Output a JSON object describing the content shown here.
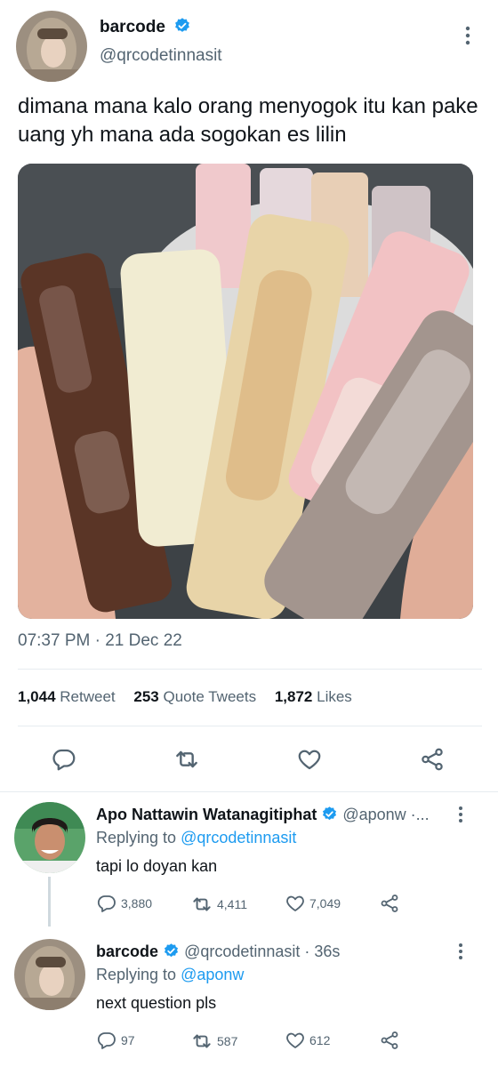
{
  "tweet": {
    "author_name": "barcode",
    "author_handle": "@qrcodetinnasit",
    "text": "dimana mana kalo orang menyogok itu kan pake uang yh mana ada sogokan es lilin",
    "timestamp": "07:37 PM · 21 Dec 22",
    "stats": {
      "retweets": "1,044",
      "retweets_label": "Retweet",
      "quotes": "253",
      "quotes_label": "Quote Tweets",
      "likes": "1,872",
      "likes_label": "Likes"
    },
    "actions": [
      "reply-icon",
      "retweet-icon",
      "like-icon",
      "share-icon"
    ]
  },
  "replies": [
    {
      "name": "Apo Nattawin Watanagitiphat",
      "handle": "@aponw ·...",
      "replying_label": "Replying to",
      "replying_to": "@qrcodetinnasit",
      "text": "tapi lo doyan kan",
      "reply_count": "3,880",
      "retweet_count": "4,411",
      "like_count": "7,049"
    },
    {
      "name": "barcode",
      "handle": "@qrcodetinnasit · 36s",
      "replying_label": "Replying to",
      "replying_to": "@aponw",
      "text": "next question pls",
      "reply_count": "97",
      "retweet_count": "587",
      "like_count": "612"
    }
  ],
  "colors": {
    "accent": "#1d9bf0",
    "text": "#0f1419",
    "secondary": "#536471",
    "divider": "#e6ecf0"
  }
}
